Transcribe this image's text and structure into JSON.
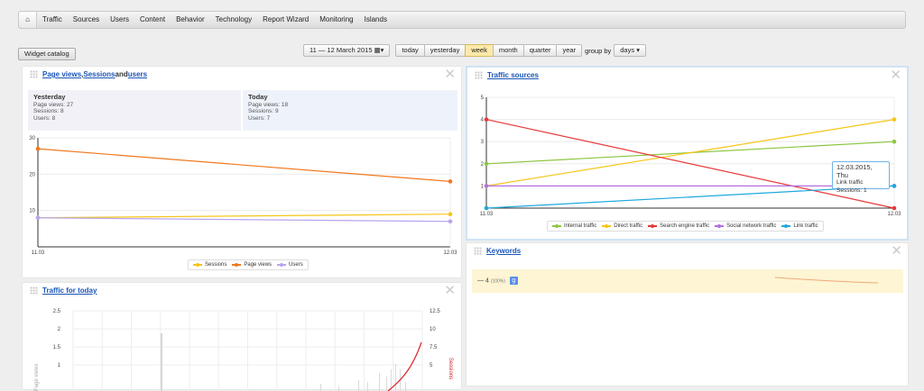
{
  "nav": {
    "items": [
      "Traffic",
      "Sources",
      "Users",
      "Content",
      "Behavior",
      "Technology",
      "Report Wizard",
      "Monitoring",
      "Islands"
    ]
  },
  "toolbar": {
    "widget_catalog": "Widget catalog",
    "date_range": "11 — 12 March 2015",
    "periods": [
      "today",
      "yesterday",
      "week",
      "month",
      "quarter",
      "year"
    ],
    "active_period": "week",
    "group_by_label": "group by",
    "group_by_value": "days"
  },
  "widgets": {
    "pageviews": {
      "title_parts": [
        "Page views",
        ", ",
        "Sessions",
        " and ",
        "users"
      ],
      "yesterday": {
        "label": "Yesterday",
        "lines": [
          "Page views: 27",
          "Sessions: 8",
          "Users: 8"
        ]
      },
      "today": {
        "label": "Today",
        "lines": [
          "Page views: 18",
          "Sessions: 9",
          "Users: 7"
        ]
      }
    },
    "sources": {
      "title": "Traffic sources"
    },
    "keywords": {
      "title": "Keywords",
      "row_text": "— 4",
      "row_pct": "(100%)",
      "icon": "google-icon"
    },
    "today_traffic": {
      "title": "Traffic for today"
    },
    "tooltip": {
      "date": "12.03.2015, Thu",
      "series": "Link traffic",
      "value": "Sessions: 1"
    }
  },
  "chart_data": [
    {
      "type": "line",
      "x": [
        "11.03",
        "12.03"
      ],
      "ylim": [
        0,
        30
      ],
      "yticks": [
        "30",
        "20",
        "10"
      ],
      "series": [
        {
          "name": "Sessions",
          "color": "#f5c518",
          "values": [
            8,
            9
          ]
        },
        {
          "name": "Page views",
          "color": "#f0781e",
          "values": [
            27,
            18
          ]
        },
        {
          "name": "Users",
          "color": "#b9a4ee",
          "values": [
            8,
            7
          ]
        }
      ]
    },
    {
      "type": "line",
      "x": [
        "11.03",
        "12.03"
      ],
      "ylim": [
        0,
        5
      ],
      "yticks": [
        "5",
        "4",
        "3",
        "2",
        "1"
      ],
      "series": [
        {
          "name": "Internal traffic",
          "color": "#8cc63f",
          "values": [
            2,
            3
          ]
        },
        {
          "name": "Direct traffic",
          "color": "#f5c518",
          "values": [
            1,
            4
          ]
        },
        {
          "name": "Search engine traffic",
          "color": "#e8393a",
          "values": [
            4,
            0
          ]
        },
        {
          "name": "Social network traffic",
          "color": "#b56ee0",
          "values": [
            1,
            1
          ]
        },
        {
          "name": "Link traffic",
          "color": "#1fa8de",
          "values": [
            0,
            1
          ]
        }
      ]
    },
    {
      "type": "line",
      "ylim_left": [
        0,
        2.5
      ],
      "yticks_left": [
        "2.5",
        "2",
        "1.5",
        "1"
      ],
      "ylim_right": [
        0,
        12.5
      ],
      "yticks_right": [
        "12.5",
        "10",
        "7.5",
        "5"
      ],
      "ylabel_left": "Page views",
      "ylabel_right": "Sessions"
    }
  ]
}
